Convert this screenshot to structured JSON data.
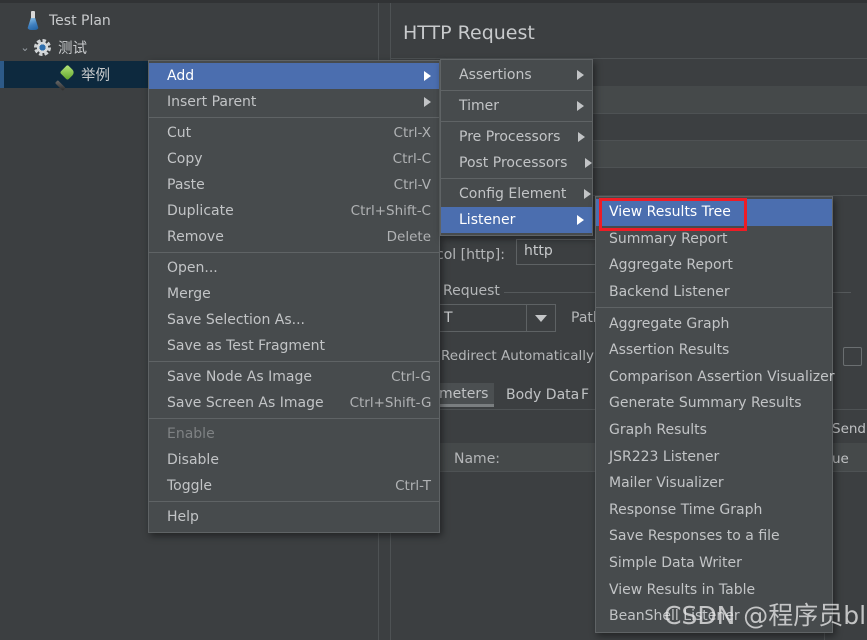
{
  "tree": {
    "nodes": [
      {
        "label": "Test Plan",
        "icon": "flask-icon",
        "selected": false,
        "expander": ""
      },
      {
        "label": "测试",
        "icon": "gear-icon",
        "selected": false,
        "expander": "⌄"
      },
      {
        "label": "举例",
        "icon": "dropper-icon",
        "selected": true,
        "expander": ""
      }
    ]
  },
  "content": {
    "title": "HTTP Request",
    "protocol_label": "col [http]:",
    "protocol_value": "http",
    "group_title": "Request",
    "method_value": "T",
    "path_label": "Patl",
    "redirect_label": "Redirect Automatically",
    "tabs": [
      {
        "label": "meters",
        "active": true
      },
      {
        "label": "Body Data",
        "active": false
      },
      {
        "label": "F",
        "active": false
      }
    ],
    "name_label": "Name:",
    "send_label": "Send",
    "value_label": "ue"
  },
  "context_menu": {
    "groups": [
      [
        {
          "label": "Add",
          "accel": "",
          "submenu": true,
          "highlight": true,
          "disabled": false
        },
        {
          "label": "Insert Parent",
          "accel": "",
          "submenu": true,
          "highlight": false,
          "disabled": false
        }
      ],
      [
        {
          "label": "Cut",
          "accel": "Ctrl-X",
          "submenu": false,
          "highlight": false,
          "disabled": false
        },
        {
          "label": "Copy",
          "accel": "Ctrl-C",
          "submenu": false,
          "highlight": false,
          "disabled": false
        },
        {
          "label": "Paste",
          "accel": "Ctrl-V",
          "submenu": false,
          "highlight": false,
          "disabled": false
        },
        {
          "label": "Duplicate",
          "accel": "Ctrl+Shift-C",
          "submenu": false,
          "highlight": false,
          "disabled": false
        },
        {
          "label": "Remove",
          "accel": "Delete",
          "submenu": false,
          "highlight": false,
          "disabled": false
        }
      ],
      [
        {
          "label": "Open...",
          "accel": "",
          "submenu": false,
          "highlight": false,
          "disabled": false
        },
        {
          "label": "Merge",
          "accel": "",
          "submenu": false,
          "highlight": false,
          "disabled": false
        },
        {
          "label": "Save Selection As...",
          "accel": "",
          "submenu": false,
          "highlight": false,
          "disabled": false
        },
        {
          "label": "Save as Test Fragment",
          "accel": "",
          "submenu": false,
          "highlight": false,
          "disabled": false
        }
      ],
      [
        {
          "label": "Save Node As Image",
          "accel": "Ctrl-G",
          "submenu": false,
          "highlight": false,
          "disabled": false
        },
        {
          "label": "Save Screen As Image",
          "accel": "Ctrl+Shift-G",
          "submenu": false,
          "highlight": false,
          "disabled": false
        }
      ],
      [
        {
          "label": "Enable",
          "accel": "",
          "submenu": false,
          "highlight": false,
          "disabled": true
        },
        {
          "label": "Disable",
          "accel": "",
          "submenu": false,
          "highlight": false,
          "disabled": false
        },
        {
          "label": "Toggle",
          "accel": "Ctrl-T",
          "submenu": false,
          "highlight": false,
          "disabled": false
        }
      ],
      [
        {
          "label": "Help",
          "accel": "",
          "submenu": false,
          "highlight": false,
          "disabled": false
        }
      ]
    ]
  },
  "add_menu": {
    "groups": [
      [
        {
          "label": "Assertions",
          "submenu": true,
          "highlight": false
        }
      ],
      [
        {
          "label": "Timer",
          "submenu": true,
          "highlight": false
        }
      ],
      [
        {
          "label": "Pre Processors",
          "submenu": true,
          "highlight": false
        },
        {
          "label": "Post Processors",
          "submenu": true,
          "highlight": false
        }
      ],
      [
        {
          "label": "Config Element",
          "submenu": true,
          "highlight": false
        },
        {
          "label": "Listener",
          "submenu": true,
          "highlight": true
        }
      ]
    ]
  },
  "listener_menu": {
    "groups": [
      [
        {
          "label": "View Results Tree",
          "highlight": true
        },
        {
          "label": "Summary Report",
          "highlight": false
        },
        {
          "label": "Aggregate Report",
          "highlight": false
        },
        {
          "label": "Backend Listener",
          "highlight": false
        }
      ],
      [
        {
          "label": "Aggregate Graph",
          "highlight": false
        },
        {
          "label": "Assertion Results",
          "highlight": false
        },
        {
          "label": "Comparison Assertion Visualizer",
          "highlight": false
        },
        {
          "label": "Generate Summary Results",
          "highlight": false
        },
        {
          "label": "Graph Results",
          "highlight": false
        },
        {
          "label": "JSR223 Listener",
          "highlight": false
        },
        {
          "label": "Mailer Visualizer",
          "highlight": false
        },
        {
          "label": "Response Time Graph",
          "highlight": false
        },
        {
          "label": "Save Responses to a file",
          "highlight": false
        },
        {
          "label": "Simple Data Writer",
          "highlight": false
        },
        {
          "label": "View Results in Table",
          "highlight": false
        },
        {
          "label": "BeanShell Listener",
          "highlight": false
        }
      ]
    ]
  },
  "annotation": {
    "highlight_color": "#ee1c25",
    "target": "View Results Tree"
  },
  "watermark": {
    "text": "CSDN @程序员bling"
  },
  "colors": {
    "app_bg": "#3c3f41",
    "menu_bg": "#474b4d",
    "menu_border": "#5f6365",
    "selection_blue": "#4b6eaf",
    "tree_selected_bg": "#0d293e",
    "text": "#c2c4c6"
  }
}
